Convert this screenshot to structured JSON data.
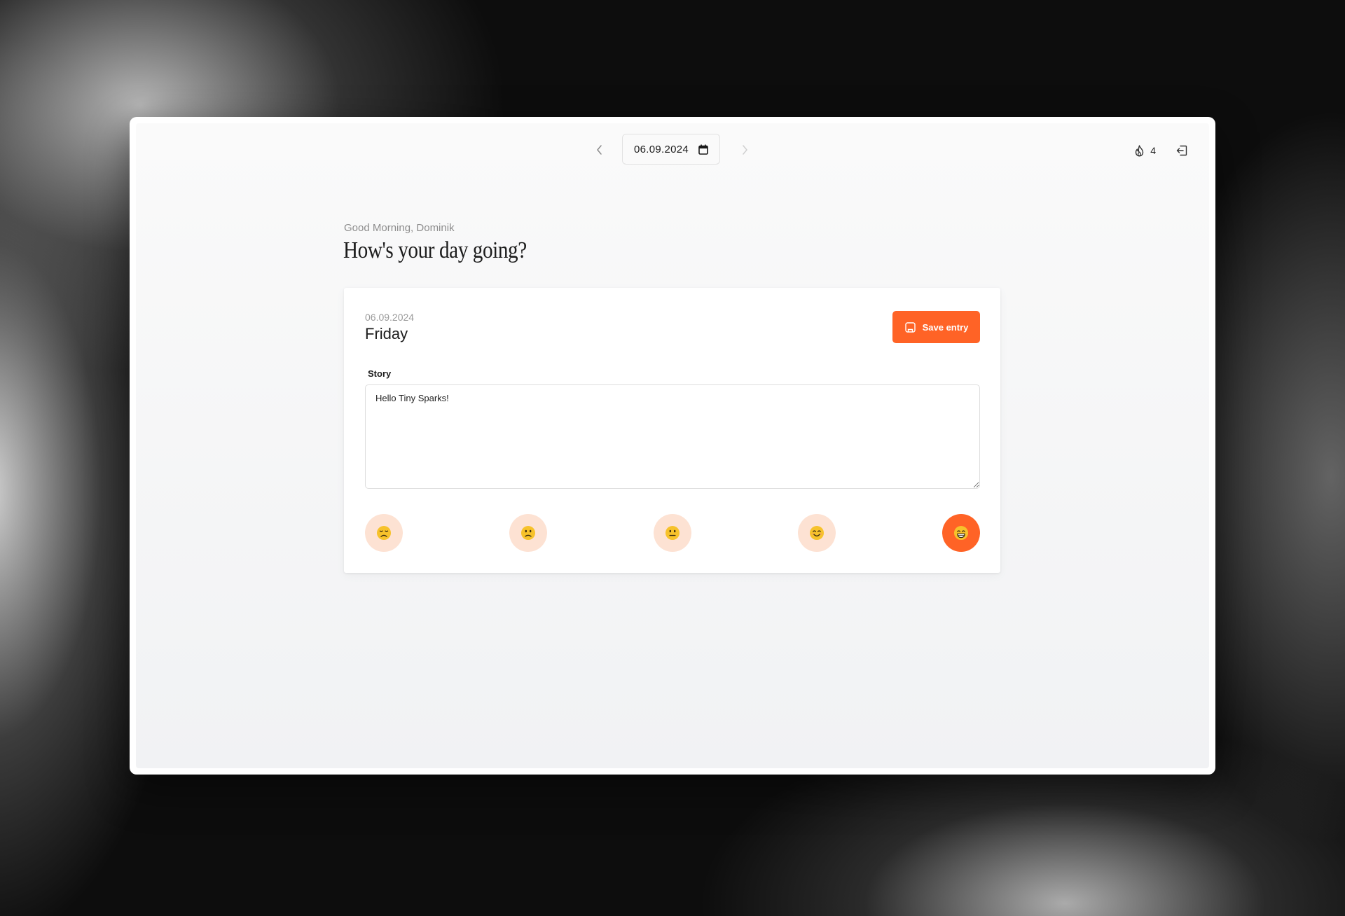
{
  "date_nav": {
    "prev_icon": "chevron-left-icon",
    "date_value": "06.09.2024",
    "calendar_icon": "calendar-icon",
    "next_icon": "chevron-right-icon"
  },
  "header_right": {
    "streak_icon": "flame-icon",
    "streak_count": "4",
    "logout_icon": "logout-icon"
  },
  "greeting": {
    "subtitle": "Good Morning, Dominik",
    "title": "How's your day going?"
  },
  "entry": {
    "date": "06.09.2024",
    "weekday": "Friday",
    "save_label": "Save entry",
    "save_icon": "save-entry-icon",
    "story_label": "Story",
    "story_value": "Hello Tiny Sparks!",
    "moods": [
      {
        "name": "very-sad",
        "icon": "sad-face-icon",
        "selected": false
      },
      {
        "name": "sad",
        "icon": "frown-face-icon",
        "selected": false
      },
      {
        "name": "neutral",
        "icon": "neutral-face-icon",
        "selected": false
      },
      {
        "name": "happy",
        "icon": "smile-face-icon",
        "selected": false
      },
      {
        "name": "very-happy",
        "icon": "grin-face-icon",
        "selected": true
      }
    ]
  },
  "colors": {
    "accent": "#ff6326",
    "mood_bg": "#fde2d3",
    "face": "#f7c22b"
  }
}
